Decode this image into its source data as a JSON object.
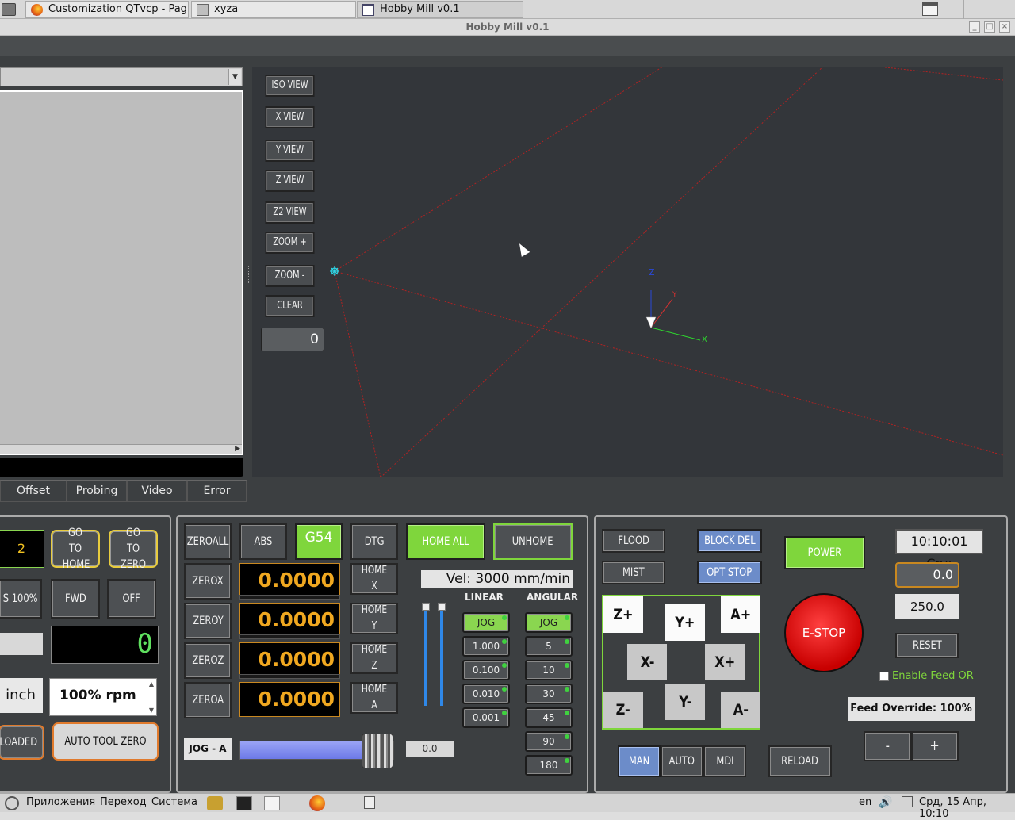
{
  "browser_tabs": [
    {
      "label": "Customization QTvcp - Pag..."
    },
    {
      "label": "xyza"
    },
    {
      "label": "Hobby Mill v0.1"
    }
  ],
  "window": {
    "title": "Hobby Mill v0.1",
    "min": "_",
    "max": "□",
    "close": "×"
  },
  "view_buttons": [
    "ISO VIEW",
    "X VIEW",
    "Y VIEW",
    "Z VIEW",
    "Z2 VIEW",
    "ZOOM +",
    "ZOOM -",
    "CLEAR"
  ],
  "view_counter": "0",
  "axes_labels": {
    "z": "Z",
    "y": "Y",
    "x": "X"
  },
  "bottom_tabs": [
    "Offset",
    "Probing",
    "Video",
    "Error"
  ],
  "spindle": {
    "tool_display": "2",
    "goto_home": "GO TO HOME",
    "goto_zero": "GO TO ZERO",
    "speed_pct": "S 100%",
    "fwd": "FWD",
    "off": "OFF",
    "lcd": "0",
    "unit": "inch",
    "rpm_value": "100% rpm",
    "file_loaded": "LE LOADED",
    "auto_tool_zero": "AUTO TOOL ZERO"
  },
  "dro": {
    "zeroall": "ZEROALL",
    "abs": "ABS",
    "g54": "G54",
    "dtg": "DTG",
    "home_all": "HOME ALL",
    "unhome": "UNHOME",
    "axes": [
      {
        "zero": "ZEROX",
        "value": "0.0000",
        "home": "HOME X"
      },
      {
        "zero": "ZEROY",
        "value": "0.0000",
        "home": "HOME Y"
      },
      {
        "zero": "ZEROZ",
        "value": "0.0000",
        "home": "HOME Z"
      },
      {
        "zero": "ZEROA",
        "value": "0.0000",
        "home": "HOME A"
      }
    ],
    "velocity": "Vel: 3000 mm/min",
    "linear_label": "LINEAR",
    "angular_label": "ANGULAR",
    "linear_steps": [
      "JOG",
      "1.000",
      "0.100",
      "0.010",
      "0.001"
    ],
    "angular_steps": [
      "JOG",
      "5",
      "10",
      "30",
      "45",
      "90",
      "180"
    ],
    "jog_axis": "JOG - A",
    "jog_value": "0.0",
    "jog_slider_fraction": 0.9
  },
  "machine": {
    "flood": "FLOOD",
    "mist": "MIST",
    "block_del": "BLOCK DEL",
    "opt_stop": "OPT STOP",
    "power": "POWER",
    "clock": "10:10:01 Срд",
    "feed_value": "0.0",
    "max_vel": "250.0",
    "estop": "E-STOP",
    "reset": "RESET",
    "enable_feed_or": "Enable Feed OR",
    "feed_override": "Feed Override: 100%",
    "minus": "-",
    "plus": "+",
    "jog_arrows": {
      "zp": "Z+",
      "yp": "Y+",
      "ap": "A+",
      "xm": "X-",
      "xp": "X+",
      "zm": "Z-",
      "ym": "Y-",
      "am": "A-"
    },
    "modes": [
      "MAN",
      "AUTO",
      "MDI"
    ],
    "reload": "RELOAD"
  },
  "taskbar": {
    "apps": "Приложения",
    "places": "Переход",
    "system": "Система",
    "lang": "en",
    "datetime": "Срд, 15 Апр, 10:10"
  },
  "colors": {
    "accent_green": "#7fd63c",
    "dro_amber": "#f0a820",
    "estop_red": "#e02020",
    "mode_blue": "#6c8cc9"
  }
}
